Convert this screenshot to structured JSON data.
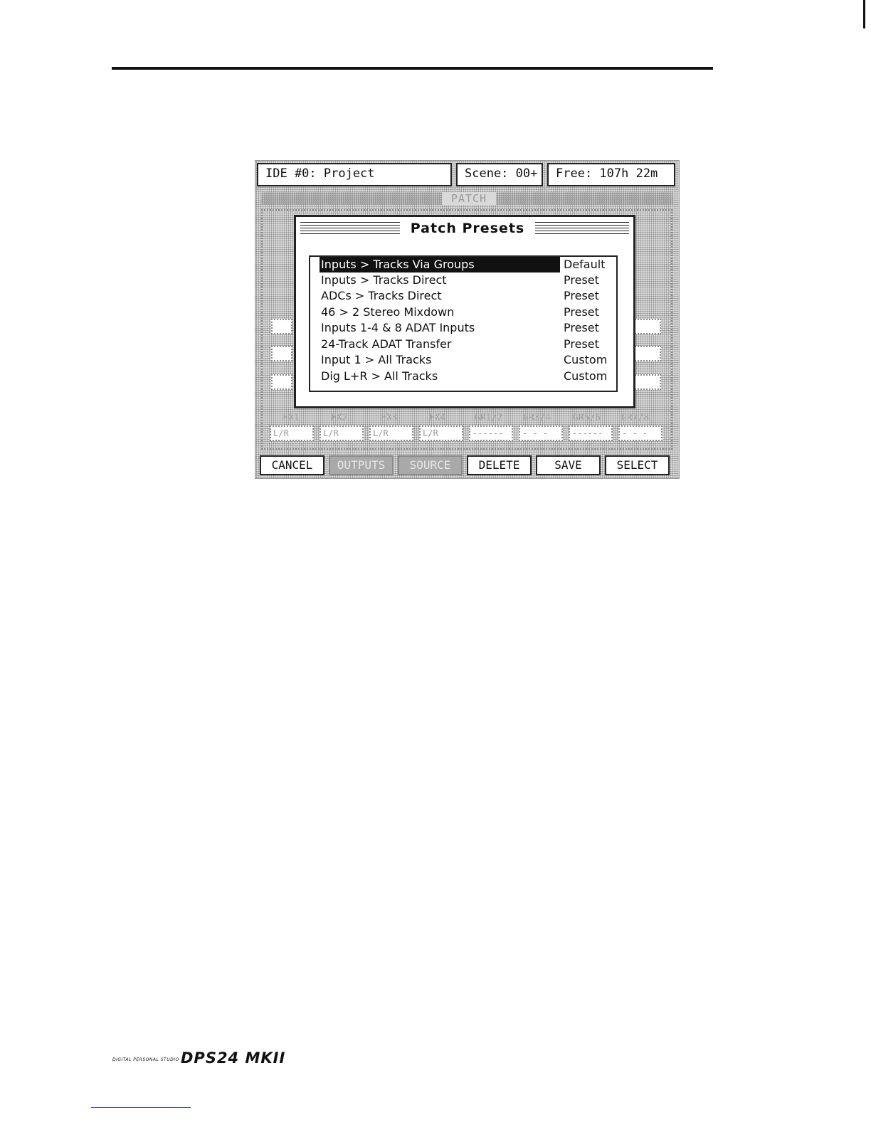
{
  "header": {
    "project": "IDE #0: Project",
    "scene": "Scene: 00+",
    "free": "Free: 107h 22m"
  },
  "panel": {
    "title": "PATCH",
    "fx_labels": [
      "FX1",
      "FX2",
      "FX3",
      "FX4",
      "GR1/2",
      "GR3/4",
      "GR5/6",
      "GR7/8"
    ],
    "fx_values": [
      "L/R",
      "L/R",
      "L/R",
      "L/R",
      "------",
      "- - -",
      "------",
      "- - -"
    ]
  },
  "dialog": {
    "title": "Patch Presets",
    "presets": [
      {
        "name": "Inputs > Tracks Via Groups",
        "type": "Default"
      },
      {
        "name": "Inputs > Tracks Direct",
        "type": "Preset"
      },
      {
        "name": "ADCs > Tracks Direct",
        "type": "Preset"
      },
      {
        "name": "46 > 2 Stereo Mixdown",
        "type": "Preset"
      },
      {
        "name": "Inputs 1-4 & 8 ADAT Inputs",
        "type": "Preset"
      },
      {
        "name": "24-Track ADAT Transfer",
        "type": "Preset"
      },
      {
        "name": "Input 1 > All Tracks",
        "type": "Custom"
      },
      {
        "name": "Dig L+R > All Tracks",
        "type": "Custom"
      }
    ],
    "selected_index": 0
  },
  "softkeys": {
    "cancel": "CANCEL",
    "outputs": "OUTPUTS",
    "source": "SOURCE",
    "delete": "DELETE",
    "save": "SAVE",
    "select": "SELECT"
  },
  "footer": {
    "subtitle": "DIGITAL PERSONAL STUDIO",
    "logo": "DPS24 MKII"
  }
}
